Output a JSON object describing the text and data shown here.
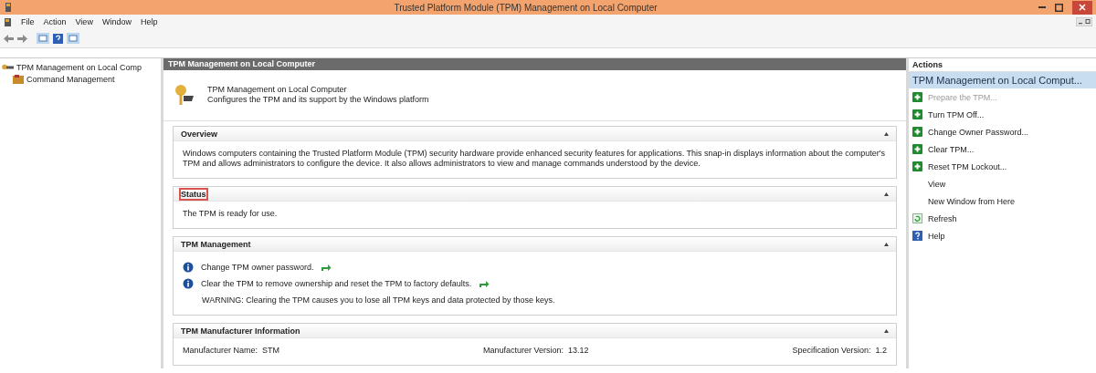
{
  "window": {
    "title": "Trusted Platform Module (TPM) Management on Local Computer"
  },
  "menu": [
    "File",
    "Action",
    "View",
    "Window",
    "Help"
  ],
  "tree": [
    {
      "label": "TPM Management on Local Comp",
      "selected": false,
      "children": [
        {
          "label": "Command Management",
          "selected": false
        }
      ]
    }
  ],
  "content": {
    "header": "TPM Management on Local Computer",
    "intro_title": "TPM Management on Local Computer",
    "intro_subtitle": "Configures the TPM and its support by the Windows platform",
    "sections": [
      {
        "kind": "text",
        "title": "Overview",
        "highlighted": false,
        "text": "Windows computers containing the Trusted Platform Module (TPM) security hardware provide enhanced security features for applications. This snap-in displays information about the computer's TPM and allows administrators to configure the device. It also allows administrators to view and manage commands understood by the device."
      },
      {
        "kind": "text",
        "title": "Status",
        "highlighted": true,
        "text": "The TPM is ready for use."
      },
      {
        "kind": "tasks",
        "title": "TPM Management",
        "highlighted": false,
        "tasks": [
          {
            "text": "Change TPM owner password."
          },
          {
            "text": "Clear the TPM to remove ownership and reset the TPM to factory defaults."
          }
        ],
        "warning": "WARNING: Clearing the TPM causes you to lose all TPM keys and data protected by those keys."
      },
      {
        "kind": "info",
        "title": "TPM Manufacturer Information",
        "highlighted": false,
        "fields": [
          {
            "label": "Manufacturer Name:",
            "value": "STM"
          },
          {
            "label": "Manufacturer Version:",
            "value": "13.12"
          },
          {
            "label": "Specification Version:",
            "value": "1.2"
          }
        ]
      }
    ]
  },
  "actions": {
    "title": "Actions",
    "group": "TPM Management on Local Comput...",
    "items": [
      {
        "kind": "task",
        "label": "Prepare the TPM...",
        "disabled": true
      },
      {
        "kind": "task",
        "label": "Turn TPM Off...",
        "disabled": false
      },
      {
        "kind": "task",
        "label": "Change Owner Password...",
        "disabled": false
      },
      {
        "kind": "task",
        "label": "Clear TPM...",
        "disabled": false
      },
      {
        "kind": "task",
        "label": "Reset TPM Lockout...",
        "disabled": false
      },
      {
        "kind": "plain",
        "label": "View",
        "disabled": false
      },
      {
        "kind": "plain",
        "label": "New Window from Here",
        "disabled": false
      },
      {
        "kind": "refresh",
        "label": "Refresh",
        "disabled": false
      },
      {
        "kind": "help",
        "label": "Help",
        "disabled": false
      }
    ]
  }
}
